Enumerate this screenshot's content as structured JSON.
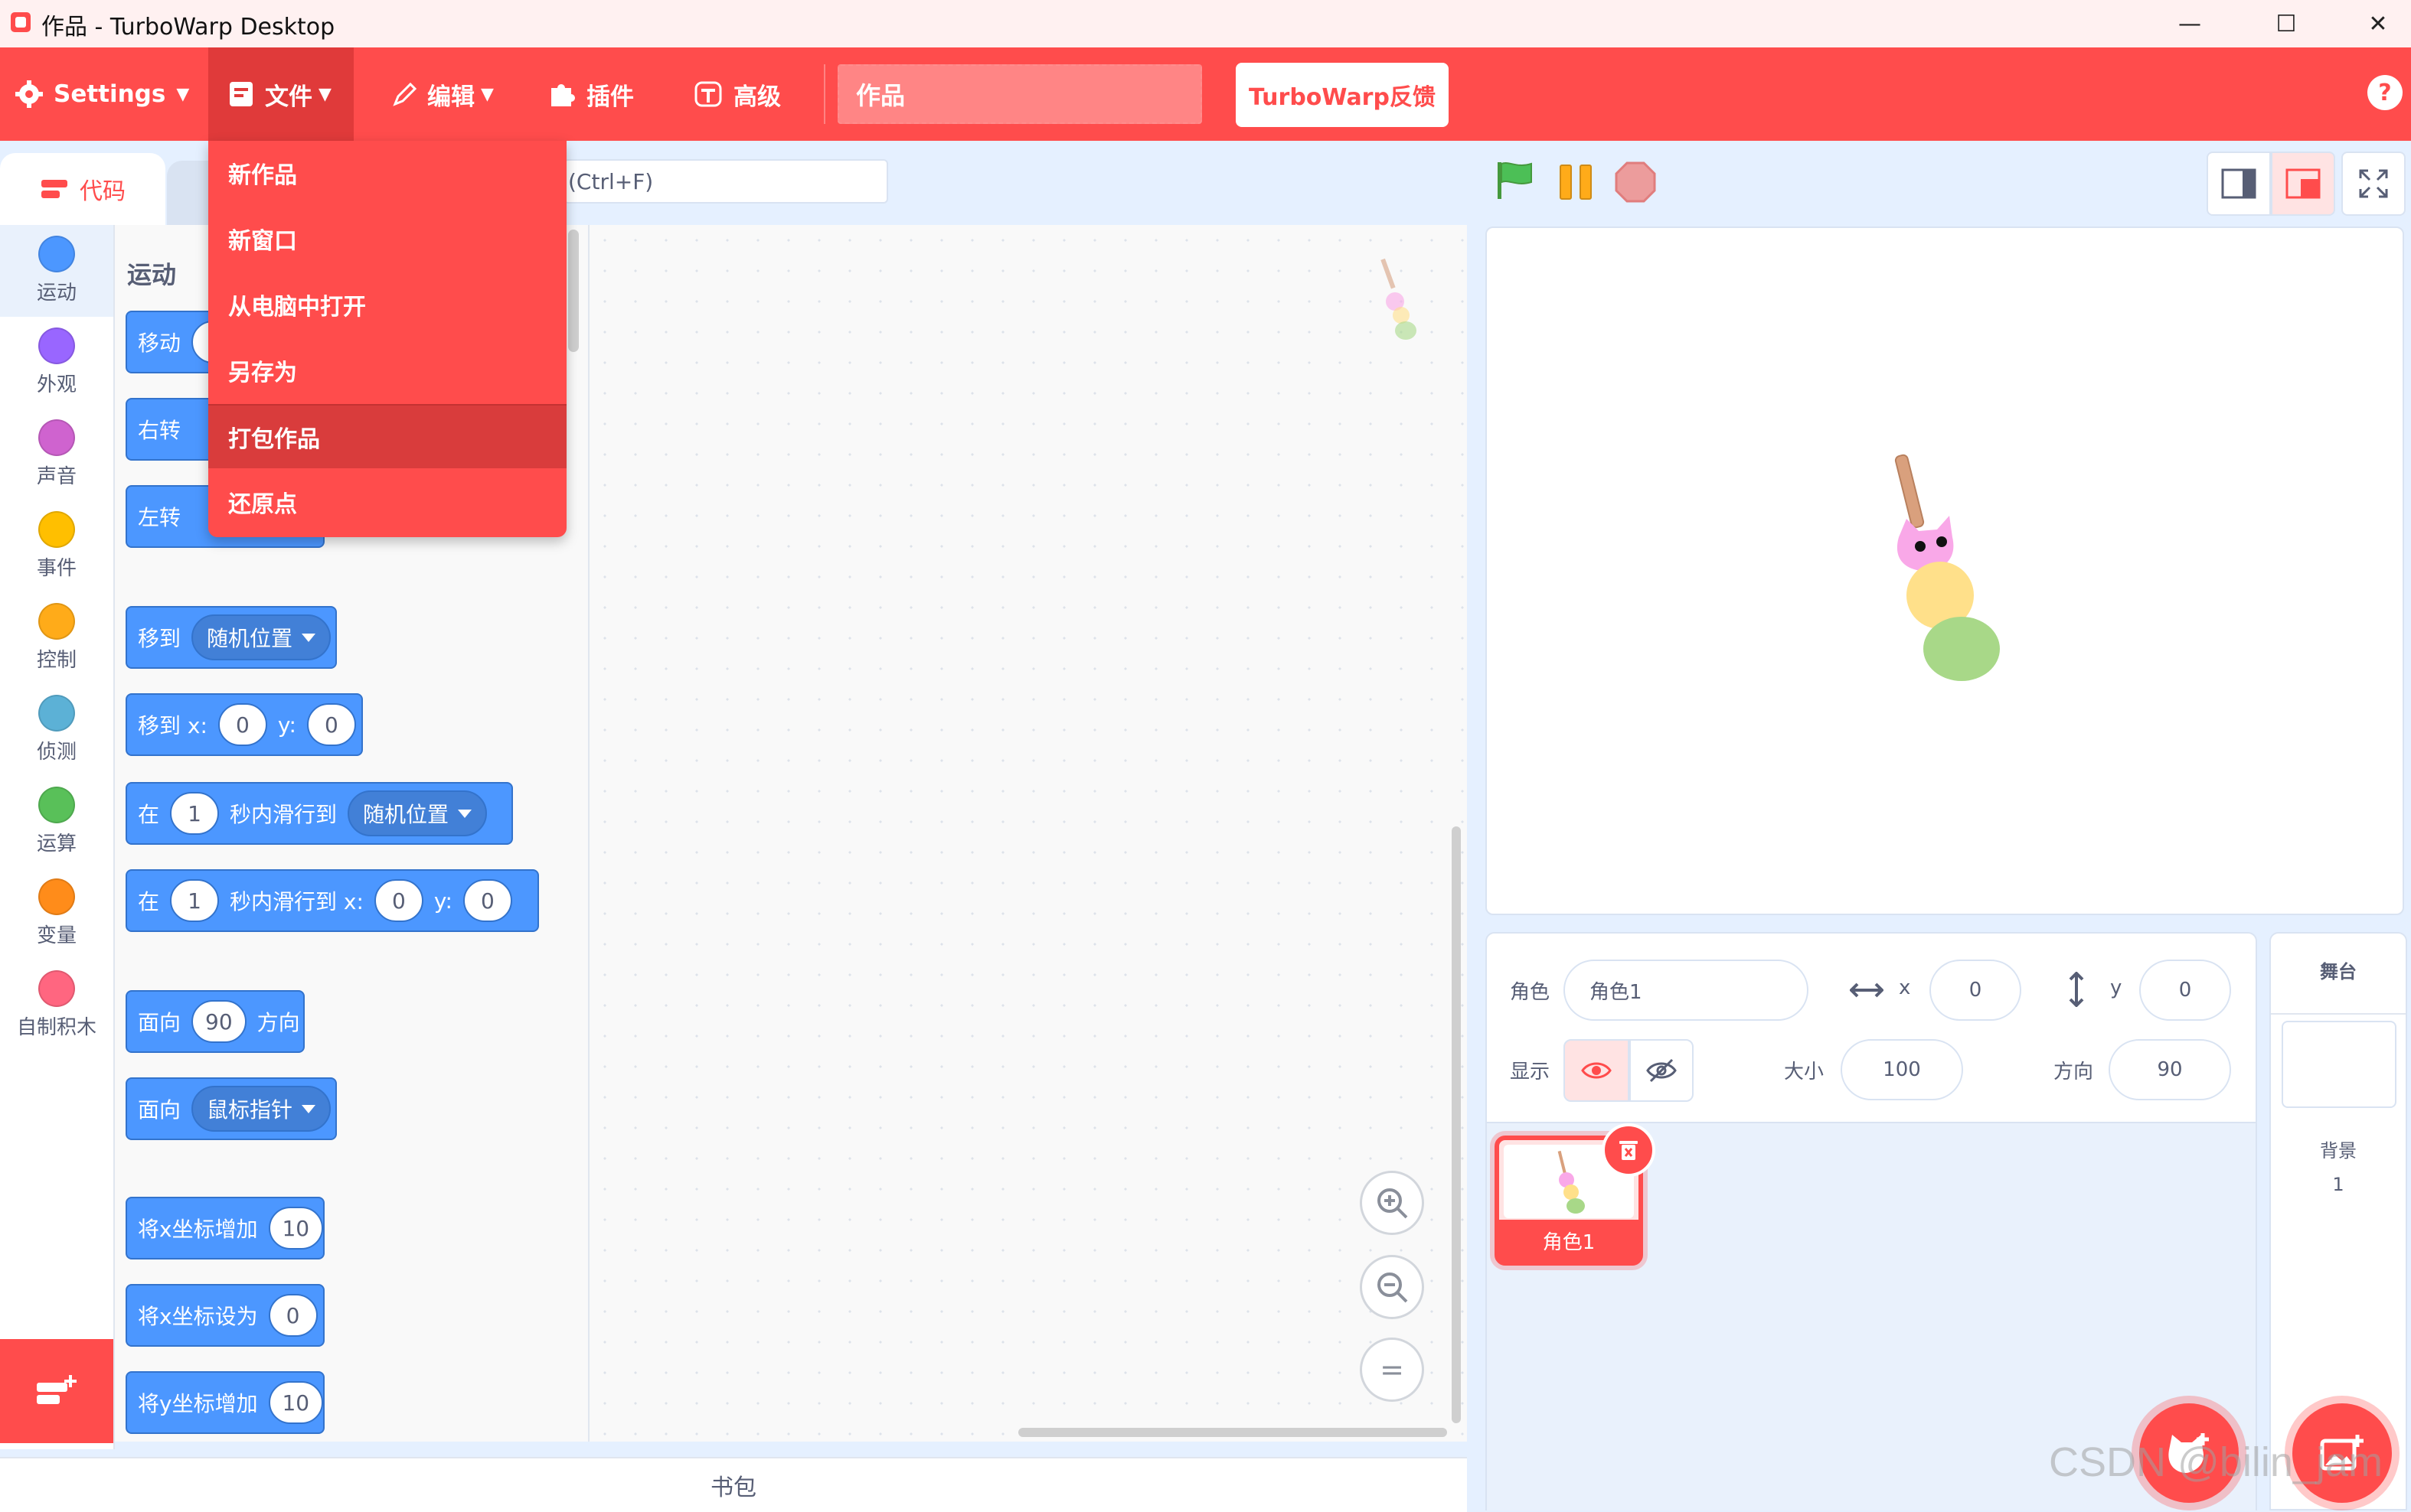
{
  "window": {
    "title": "作品 - TurboWarp Desktop",
    "minimize": "—",
    "maximize": "☐",
    "close": "✕"
  },
  "menubar": {
    "settings": "Settings",
    "file": "文件",
    "edit": "编辑",
    "addons": "插件",
    "advanced": "高级",
    "project_title": "作品",
    "feedback": "TurboWarp反馈",
    "help": "?"
  },
  "file_menu": {
    "items": [
      "新作品",
      "新窗口",
      "从电脑中打开",
      "另存为",
      "打包作品",
      "还原点"
    ],
    "highlighted": "打包作品"
  },
  "tabs": {
    "code": "代码"
  },
  "search": {
    "placeholder": "(Ctrl+F)"
  },
  "categories": [
    {
      "label": "运动",
      "color": "#4c97ff"
    },
    {
      "label": "外观",
      "color": "#9966ff"
    },
    {
      "label": "声音",
      "color": "#cf63cf"
    },
    {
      "label": "事件",
      "color": "#ffbf00"
    },
    {
      "label": "控制",
      "color": "#ffab19"
    },
    {
      "label": "侦测",
      "color": "#5cb1d6"
    },
    {
      "label": "运算",
      "color": "#59c059"
    },
    {
      "label": "变量",
      "color": "#ff8c1a"
    },
    {
      "label": "自制积木",
      "color": "#ff6680"
    }
  ],
  "flyout": {
    "section_title": "运动",
    "blocks": {
      "move": "移动",
      "turn_right": "右转",
      "turn_left": "左转",
      "goto": "移到",
      "goto_menu": "随机位置",
      "goto_xy": "移到 x:",
      "goto_x_val": "0",
      "y_label": "y:",
      "goto_y_val": "0",
      "glide_prefix": "在",
      "glide_secs": "1",
      "glide_to": "秒内滑行到",
      "glide_menu": "随机位置",
      "glide_xy_prefix": "在",
      "glide_xy_secs": "1",
      "glide_xy_to": "秒内滑行到 x:",
      "glide_xy_x": "0",
      "glide_xy_ylabel": "y:",
      "glide_xy_y": "0",
      "point_dir": "面向",
      "point_dir_val": "90",
      "point_dir_suffix": "方向",
      "point_towards": "面向",
      "point_towards_menu": "鼠标指针",
      "change_x": "将x坐标增加",
      "change_x_val": "10",
      "set_x": "将x坐标设为",
      "set_x_val": "0",
      "change_y": "将y坐标增加",
      "change_y_val": "10"
    }
  },
  "workspace": {
    "zoom_in": "+",
    "zoom_out": "−",
    "zoom_reset": "="
  },
  "backpack": "书包",
  "sprite_info": {
    "sprite_label": "角色",
    "sprite_name": "角色1",
    "x_label": "x",
    "x_value": "0",
    "y_label": "y",
    "y_value": "0",
    "show_label": "显示",
    "size_label": "大小",
    "size_value": "100",
    "direction_label": "方向",
    "direction_value": "90"
  },
  "sprites": [
    {
      "name": "角色1"
    }
  ],
  "stage_panel": {
    "title": "舞台",
    "backdrop_label": "背景",
    "backdrop_count": "1"
  },
  "watermark": "CSDN @bilin_jam",
  "colors": {
    "accent": "#ff4c4c",
    "motion": "#4c97ff"
  }
}
